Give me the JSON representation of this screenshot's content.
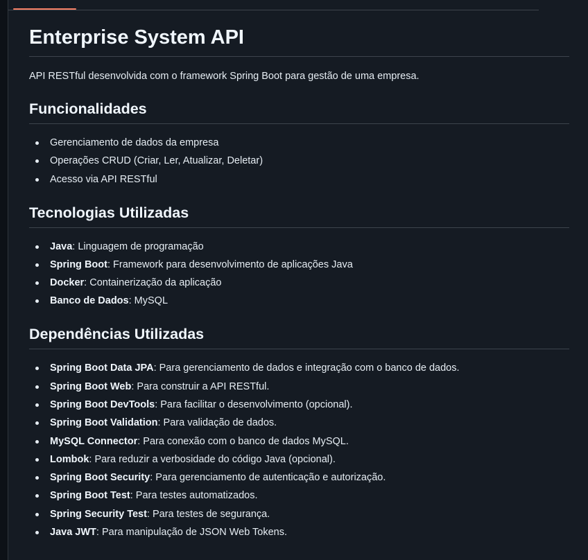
{
  "title": "Enterprise System API",
  "intro": "API RESTful desenvolvida com o framework Spring Boot para gestão de uma empresa.",
  "sections": {
    "funcionalidades": {
      "heading": "Funcionalidades",
      "items": [
        "Gerenciamento de dados da empresa",
        "Operações CRUD (Criar, Ler, Atualizar, Deletar)",
        "Acesso via API RESTful"
      ]
    },
    "tecnologias": {
      "heading": "Tecnologias Utilizadas",
      "items": [
        {
          "name": "Java",
          "desc": ": Linguagem de programação"
        },
        {
          "name": "Spring Boot",
          "desc": ": Framework para desenvolvimento de aplicações Java"
        },
        {
          "name": "Docker",
          "desc": ": Containerização da aplicação"
        },
        {
          "name": "Banco de Dados",
          "desc": ": MySQL"
        }
      ]
    },
    "dependencias": {
      "heading": "Dependências Utilizadas",
      "items": [
        {
          "name": "Spring Boot Data JPA",
          "desc": ": Para gerenciamento de dados e integração com o banco de dados."
        },
        {
          "name": "Spring Boot Web",
          "desc": ": Para construir a API RESTful."
        },
        {
          "name": "Spring Boot DevTools",
          "desc": ": Para facilitar o desenvolvimento (opcional)."
        },
        {
          "name": "Spring Boot Validation",
          "desc": ": Para validação de dados."
        },
        {
          "name": "MySQL Connector",
          "desc": ": Para conexão com o banco de dados MySQL."
        },
        {
          "name": "Lombok",
          "desc": ": Para reduzir a verbosidade do código Java (opcional)."
        },
        {
          "name": "Spring Boot Security",
          "desc": ": Para gerenciamento de autenticação e autorização."
        },
        {
          "name": "Spring Boot Test",
          "desc": ": Para testes automatizados."
        },
        {
          "name": "Spring Security Test",
          "desc": ": Para testes de segurança."
        },
        {
          "name": "Java JWT",
          "desc": ": Para manipulação de JSON Web Tokens."
        }
      ]
    }
  },
  "colors": {
    "background": "#0d1117",
    "panel": "#151b23",
    "text": "#e6edf3",
    "divider": "#3d444d",
    "tab_accent": "#f78166"
  }
}
